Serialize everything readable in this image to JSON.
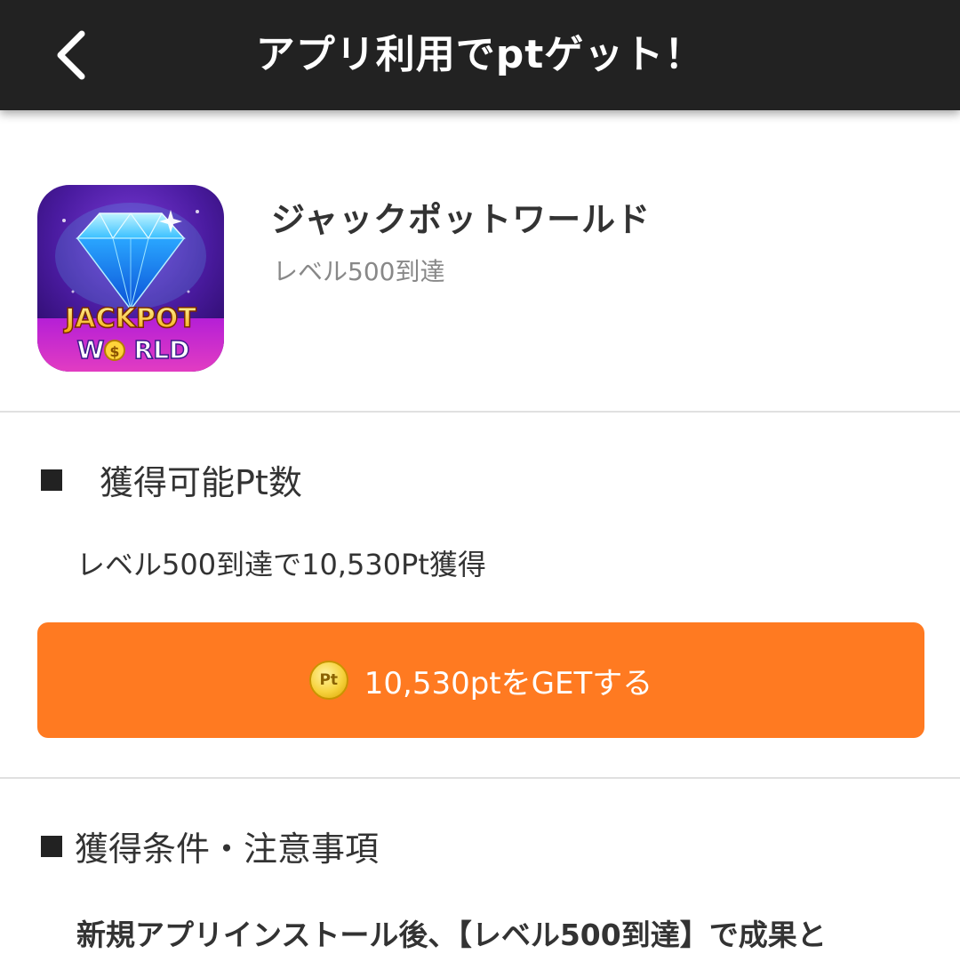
{
  "header": {
    "title": "アプリ利用でptゲット！",
    "back_icon": "chevron-left-icon"
  },
  "app": {
    "name": "ジャックポットワールド",
    "condition": "レベル500到達",
    "icon": {
      "line1": "JACKPOT",
      "line2_a": "W",
      "line2_b": "RLD",
      "coin_symbol": "$"
    }
  },
  "points_section": {
    "heading": "獲得可能Pt数",
    "description": "レベル500到達で10,530Pt獲得"
  },
  "get_button": {
    "coin_label": "Pt",
    "label": "10,530ptをGETする"
  },
  "terms_section": {
    "heading": "獲得条件・注意事項",
    "text": "新規アプリインストール後、【レベル500到達】で成果と"
  },
  "colors": {
    "header_bg": "#222222",
    "accent": "#ff7a21",
    "divider": "#e0e0e0",
    "muted_text": "#888888"
  }
}
